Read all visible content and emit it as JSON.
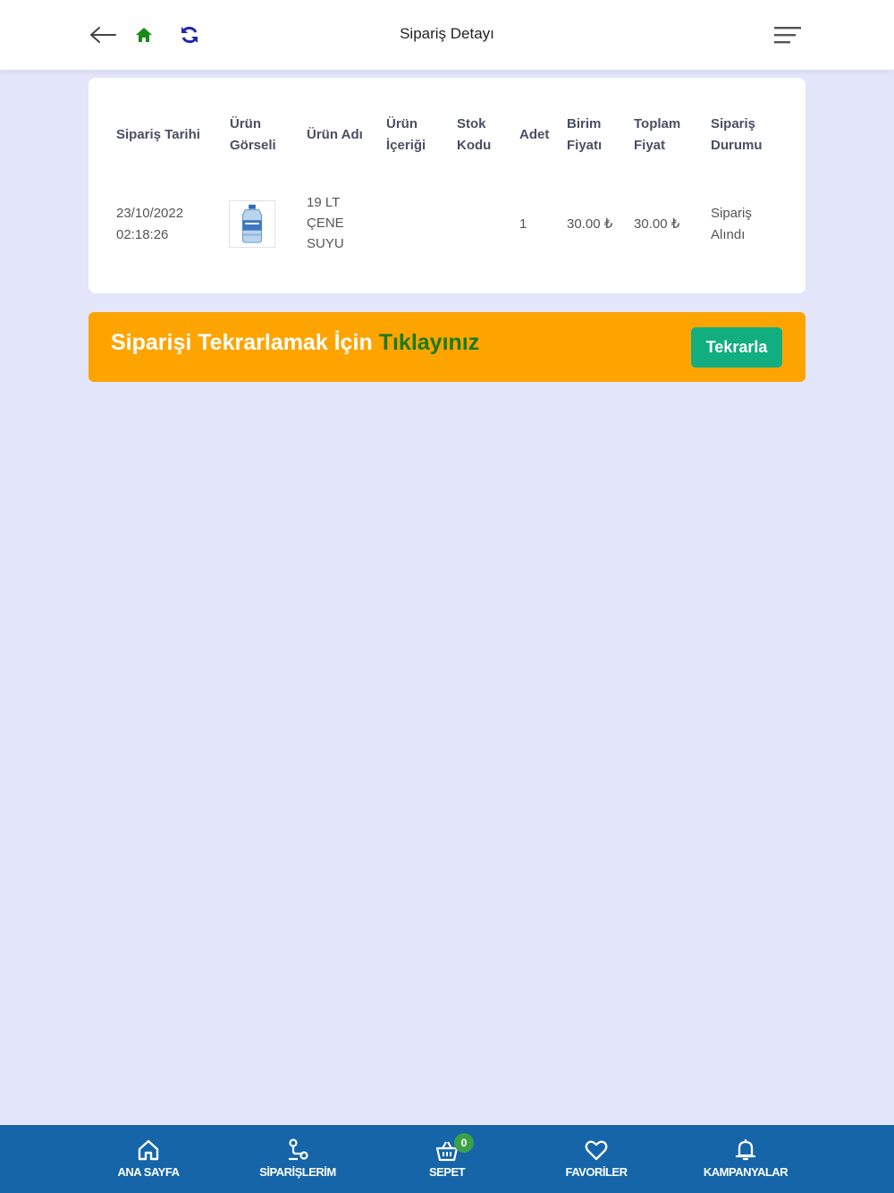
{
  "header": {
    "title": "Sipariş Detayı"
  },
  "table": {
    "headers": [
      [
        "Sipariş Tarihi"
      ],
      [
        "Ürün",
        "Görseli"
      ],
      [
        "Ürün Adı"
      ],
      [
        "Ürün",
        "İçeriği"
      ],
      [
        "Stok",
        "Kodu"
      ],
      [
        "Adet"
      ],
      [
        "Birim",
        "Fiyatı"
      ],
      [
        "Toplam",
        "Fiyat"
      ],
      [
        "Sipariş",
        "Durumu"
      ]
    ],
    "row": {
      "date": [
        "23/10/2022",
        "02:18:26"
      ],
      "product_name": [
        "19 LT",
        "ÇENE",
        "SUYU"
      ],
      "content": "",
      "stock_code": "",
      "quantity": "1",
      "unit_price": "30.00 ₺",
      "total_price": "30.00 ₺",
      "status": [
        "Sipariş",
        "Alındı"
      ]
    }
  },
  "banner": {
    "text": "Siparişi Tekrarlamak İçin",
    "highlight": "Tıklayınız",
    "button": "Tekrarla"
  },
  "bottom_nav": {
    "items": [
      {
        "label": "ANA SAYFA",
        "icon": "home-icon"
      },
      {
        "label": "SİPARİŞLERİM",
        "icon": "orders-icon"
      },
      {
        "label": "SEPET",
        "icon": "basket-icon",
        "badge": "0"
      },
      {
        "label": "FAVORİLER",
        "icon": "heart-icon"
      },
      {
        "label": "KAMPANYALAR",
        "icon": "bell-icon"
      }
    ]
  },
  "colors": {
    "background": "#e3e5fb",
    "banner": "#fea400",
    "button": "#12ae80",
    "nav": "#1565a8",
    "highlight": "#1a7a1a"
  }
}
